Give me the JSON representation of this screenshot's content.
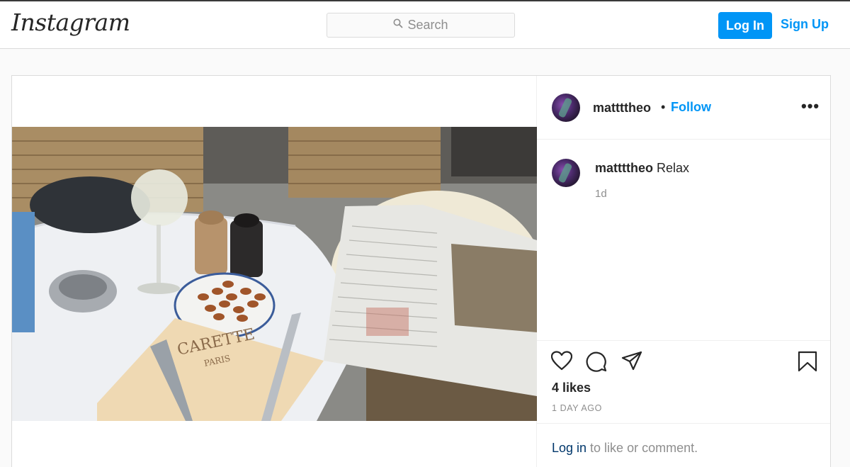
{
  "header": {
    "logo": "Instagram",
    "search_placeholder": "Search",
    "login_label": "Log In",
    "signup_label": "Sign Up"
  },
  "post": {
    "username": "mattttheo",
    "separator": "•",
    "follow_label": "Follow",
    "more_label": "•••",
    "caption": {
      "username": "mattttheo",
      "text": "Relax",
      "time": "1d"
    },
    "likes": "4 likes",
    "timestamp": "1 DAY AGO",
    "login_prompt": {
      "link": "Log in",
      "text": " to like or comment."
    },
    "photo_menu": {
      "brand": "CARETTE",
      "city": "PARIS"
    }
  },
  "icons": {
    "search": "search-icon",
    "like": "heart-icon",
    "comment": "comment-icon",
    "share": "share-icon",
    "save": "bookmark-icon",
    "more": "more-options-icon"
  },
  "colors": {
    "accent": "#0095f6",
    "link_dark": "#00376b",
    "muted": "#8e8e8e",
    "border": "#dbdbdb",
    "background": "#fafafa"
  }
}
